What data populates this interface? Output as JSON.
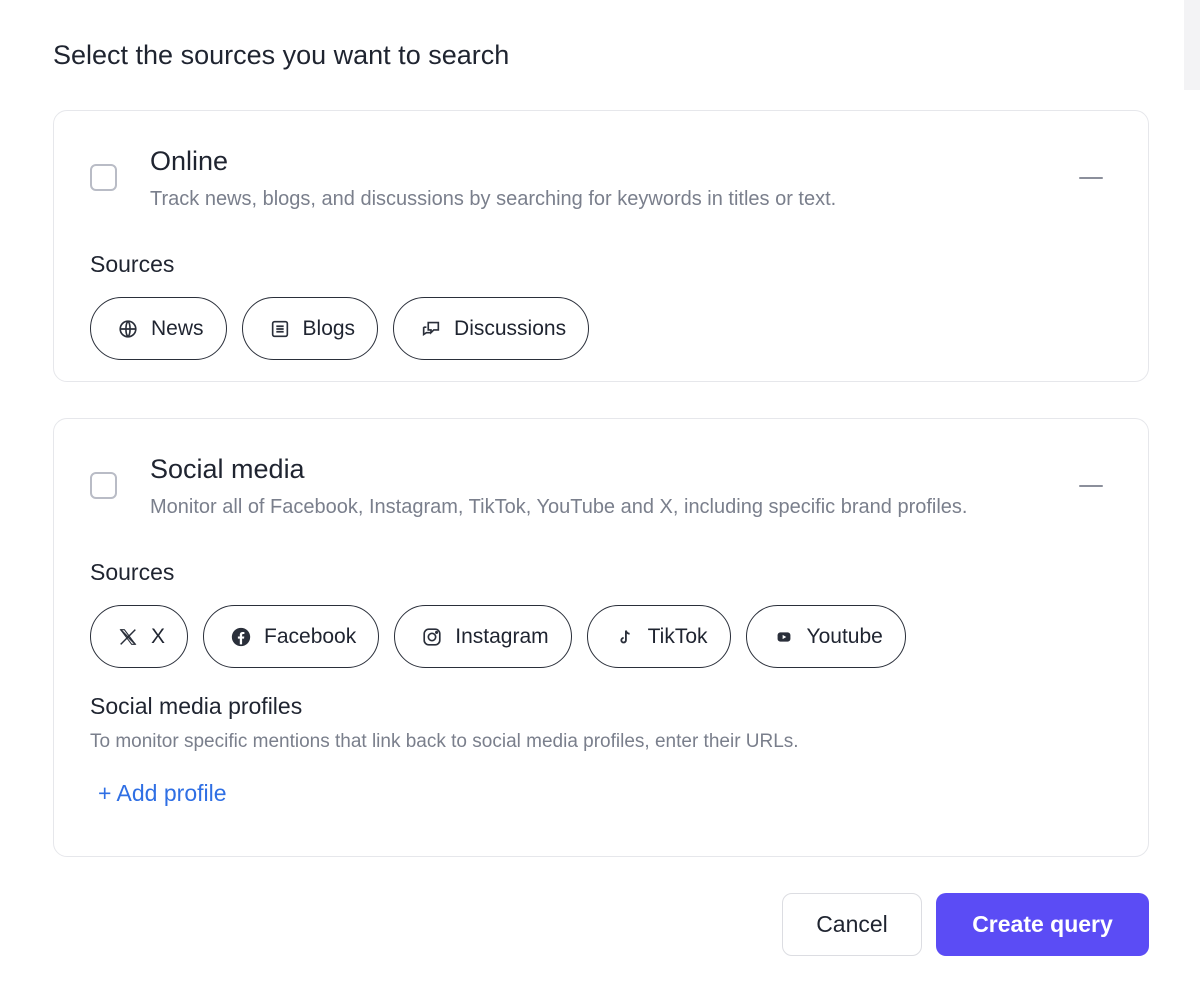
{
  "page_title": "Select the sources you want to search",
  "online": {
    "title": "Online",
    "description": "Track news, blogs, and discussions by searching for keywords in titles or text.",
    "sources_label": "Sources",
    "chips": [
      "News",
      "Blogs",
      "Discussions"
    ],
    "checked": false
  },
  "social": {
    "title": "Social media",
    "description": "Monitor all of Facebook, Instagram, TikTok, YouTube and X, including specific brand profiles.",
    "sources_label": "Sources",
    "chips": [
      "X",
      "Facebook",
      "Instagram",
      "TikTok",
      "Youtube"
    ],
    "checked": false,
    "profiles_title": "Social media profiles",
    "profiles_description": "To monitor specific mentions that link back to social media profiles, enter their URLs.",
    "add_profile_label": "+ Add profile"
  },
  "actions": {
    "cancel_label": "Cancel",
    "create_label": "Create query"
  },
  "colors": {
    "accent": "#5b4cf5",
    "link": "#2f6fe4"
  },
  "icons": {
    "online_chips": [
      "globe-icon",
      "blog-icon",
      "discussion-icon"
    ],
    "social_chips": [
      "x-logo-icon",
      "facebook-icon",
      "instagram-icon",
      "tiktok-icon",
      "youtube-icon"
    ]
  }
}
